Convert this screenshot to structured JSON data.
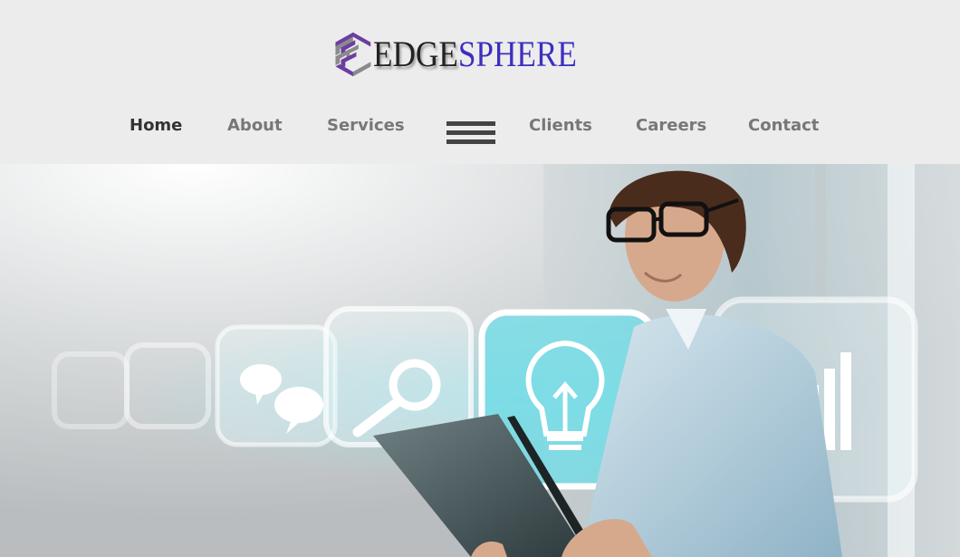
{
  "brand": {
    "part1": "EDGE",
    "part2": "SPHERE",
    "accent_color": "#3b2fc0",
    "logo_colors": [
      "#6a3fa0",
      "#8a8a8a"
    ]
  },
  "nav": {
    "items": [
      {
        "label": "Home",
        "active": true
      },
      {
        "label": "About",
        "active": false
      },
      {
        "label": "Services",
        "active": false
      },
      {
        "label": "Clients",
        "active": false
      },
      {
        "label": "Careers",
        "active": false
      },
      {
        "label": "Contact",
        "active": false
      }
    ],
    "menu_icon": "hamburger-menu-icon"
  },
  "hero": {
    "icons": [
      "chat-bubbles-icon",
      "search-icon",
      "lightbulb-icon",
      "bar-chart-icon"
    ]
  }
}
